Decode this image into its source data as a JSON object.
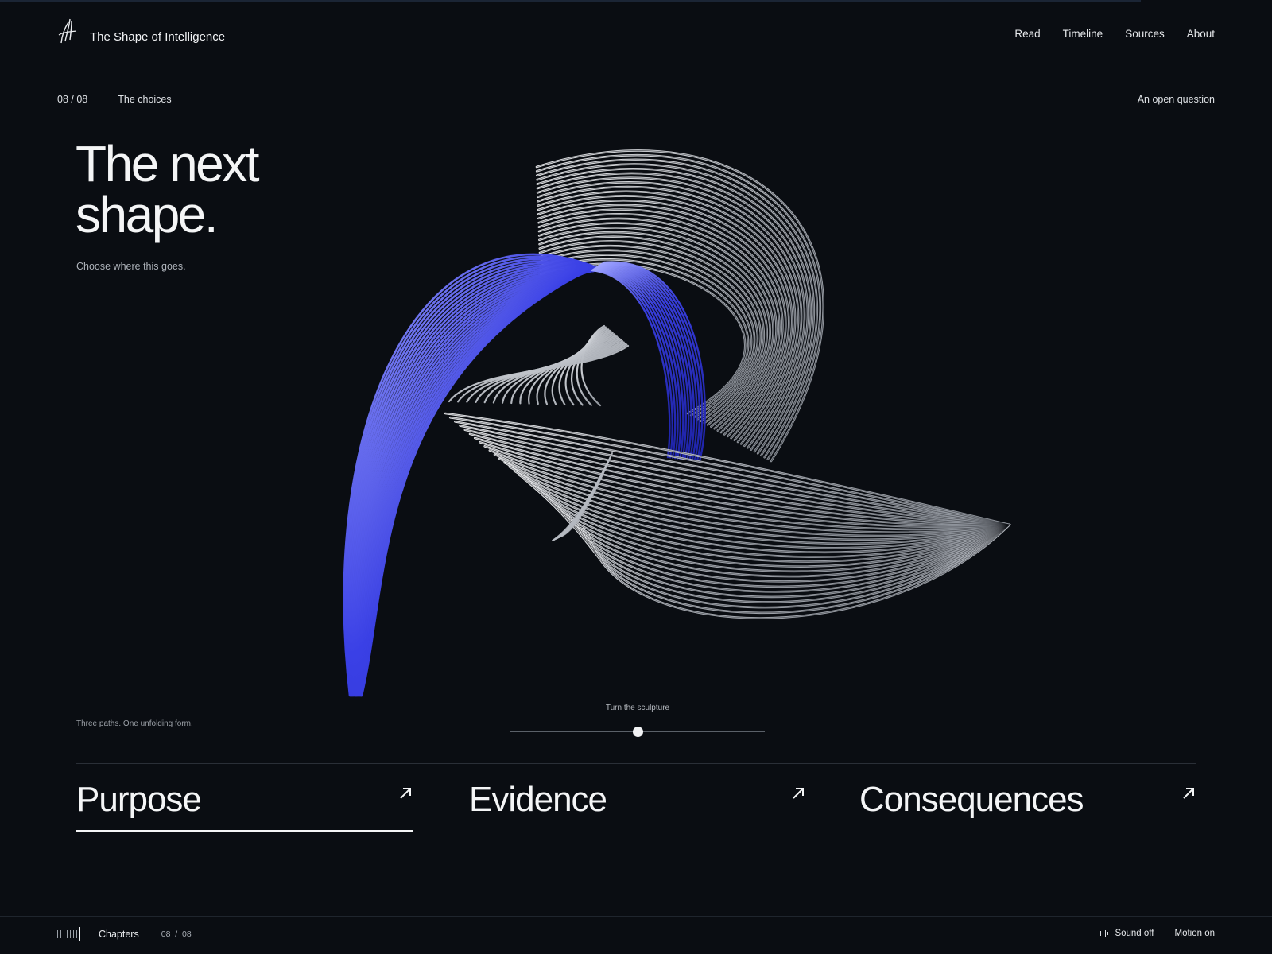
{
  "site": {
    "title": "The Shape of Intelligence"
  },
  "nav": {
    "items": [
      "Read",
      "Timeline",
      "Sources",
      "About"
    ]
  },
  "chapter": {
    "index": "08 / 08",
    "name": "The choices",
    "tag": "An open question",
    "headline_line1": "The next",
    "headline_line2": "shape.",
    "subtitle": "Choose where this goes.",
    "caption": "Three paths. One unfolding form."
  },
  "slider": {
    "label": "Turn the sculpture",
    "value": 0.5
  },
  "choices": [
    {
      "label": "Purpose",
      "active": true
    },
    {
      "label": "Evidence",
      "active": false
    },
    {
      "label": "Consequences",
      "active": false
    }
  ],
  "footer": {
    "chapters_label": "Chapters",
    "current_page": "08",
    "separator": "/",
    "total_pages": "08",
    "sound_label": "Sound off",
    "motion_label": "Motion on"
  },
  "colors": {
    "background": "#0a0d12",
    "ribbon_blue": "#2f35d8",
    "ribbon_silver": "#d4d7dc"
  },
  "icons": [
    "logo-mark-icon",
    "arrow-up-right-icon",
    "chapters-bars-icon",
    "sound-wave-icon"
  ]
}
